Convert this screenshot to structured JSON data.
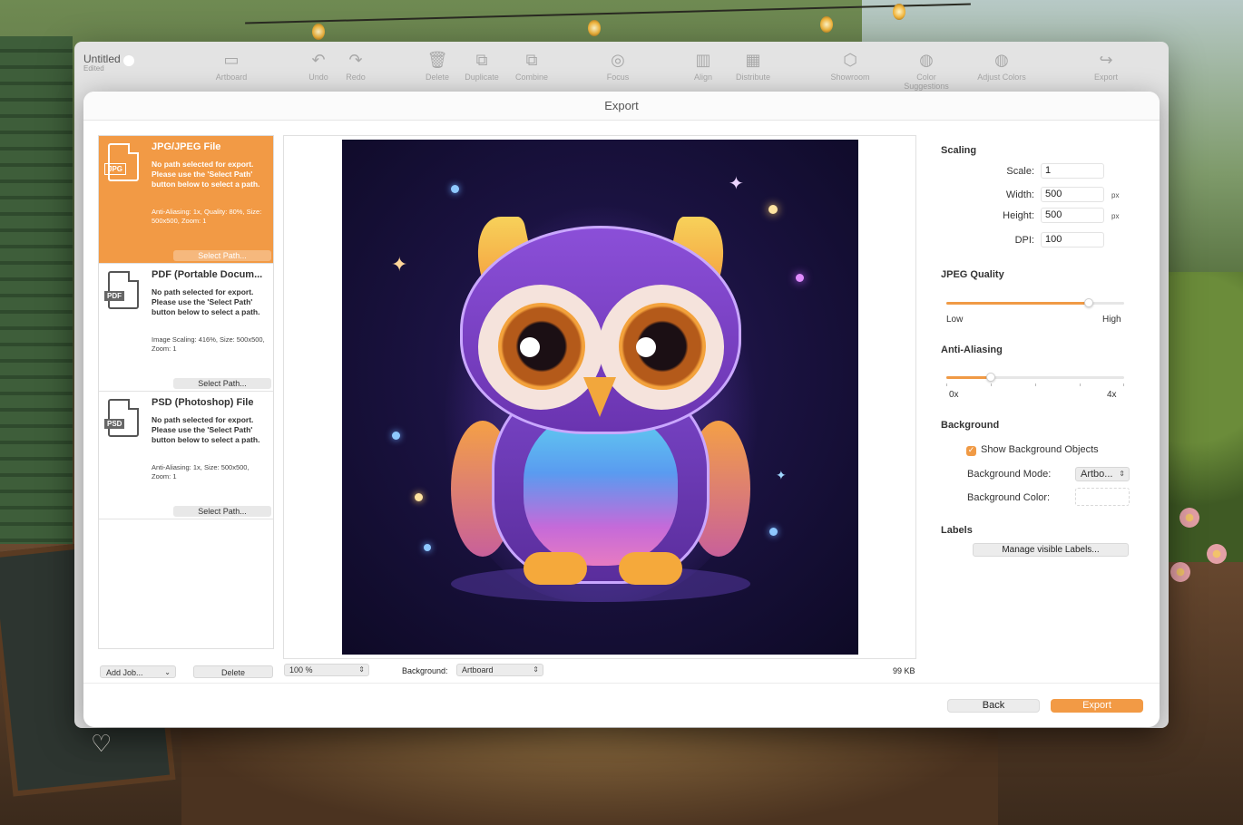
{
  "app": {
    "title": "Untitled",
    "subtitle": "Edited",
    "toolbar": [
      {
        "label": "Artboard",
        "icon": "artboard-icon",
        "glyph": "▭"
      },
      {
        "label": "Undo",
        "icon": "undo-icon",
        "glyph": "↶"
      },
      {
        "label": "Redo",
        "icon": "redo-icon",
        "glyph": "↷"
      },
      {
        "label": "Delete",
        "icon": "trash-icon",
        "glyph": "🗑"
      },
      {
        "label": "Duplicate",
        "icon": "duplicate-icon",
        "glyph": "⧉"
      },
      {
        "label": "Combine",
        "icon": "combine-icon",
        "glyph": "⧉"
      },
      {
        "label": "Focus",
        "icon": "focus-icon",
        "glyph": "◎"
      },
      {
        "label": "Align",
        "icon": "align-icon",
        "glyph": "▥"
      },
      {
        "label": "Distribute",
        "icon": "distribute-icon",
        "glyph": "▦"
      },
      {
        "label": "Showroom",
        "icon": "cube-icon",
        "glyph": "⬡"
      },
      {
        "label": "Color Suggestions",
        "icon": "palette-icon",
        "glyph": "◍"
      },
      {
        "label": "Adjust Colors",
        "icon": "palette-adjust-icon",
        "glyph": "◍"
      },
      {
        "label": "Export",
        "icon": "share-icon",
        "glyph": "↪"
      }
    ]
  },
  "dialog": {
    "title": "Export",
    "jobs": [
      {
        "tag": "JPG",
        "title": "JPG/JPEG File",
        "note": "No path selected for export. Please use the 'Select Path' button below to select a path.",
        "info": "Anti-Aliasing: 1x, Quality: 80%, Size: 500x500, Zoom: 1",
        "button": "Select Path...",
        "selected": true
      },
      {
        "tag": "PDF",
        "title": "PDF (Portable Docum...",
        "note": "No path selected for export. Please use the 'Select Path' button below to select a path.",
        "info": "Image Scaling: 416%, Size: 500x500, Zoom: 1",
        "button": "Select Path...",
        "selected": false
      },
      {
        "tag": "PSD",
        "title": "PSD (Photoshop) File",
        "note": "No path selected for export. Please use the 'Select Path' button below to select a path.",
        "info": "Anti-Aliasing: 1x, Size: 500x500, Zoom: 1",
        "button": "Select Path...",
        "selected": false
      }
    ],
    "add_job": "Add Job...",
    "delete": "Delete",
    "zoom": "100 %",
    "background_label": "Background:",
    "background_value": "Artboard",
    "file_size": "99 KB",
    "settings": {
      "scaling_title": "Scaling",
      "scale_label": "Scale:",
      "scale_value": "1",
      "width_label": "Width:",
      "width_value": "500",
      "height_label": "Height:",
      "height_value": "500",
      "dpi_label": "DPI:",
      "dpi_value": "100",
      "unit": "px",
      "jpeg_title": "JPEG Quality",
      "jpeg_low": "Low",
      "jpeg_high": "High",
      "jpeg_quality": 0.8,
      "aa_title": "Anti-Aliasing",
      "aa_min": "0x",
      "aa_max": "4x",
      "aa_value": 1,
      "bg_title": "Background",
      "show_bg_objects": "Show Background Objects",
      "show_bg_checked": true,
      "bg_mode_label": "Background Mode:",
      "bg_mode_value": "Artbo...",
      "bg_color_label": "Background Color:",
      "labels_title": "Labels",
      "manage_labels": "Manage visible Labels..."
    },
    "back": "Back",
    "export": "Export"
  },
  "colors": {
    "accent": "#f29a45"
  }
}
